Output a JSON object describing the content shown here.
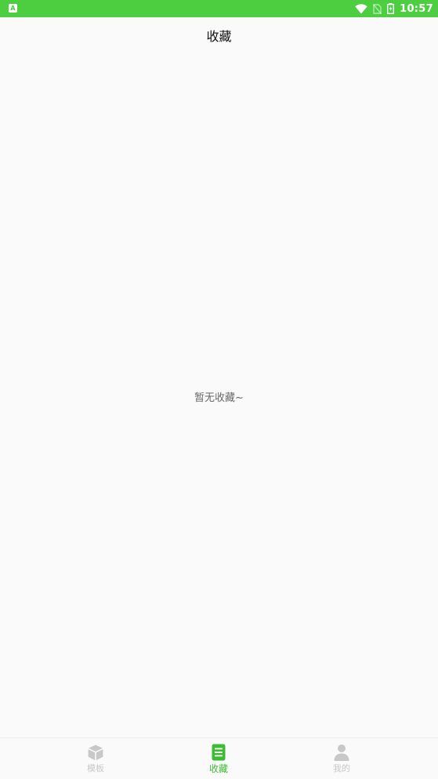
{
  "status_bar": {
    "left_icon": "A",
    "time": "10:57",
    "icons": [
      "wifi-icon",
      "no-sim-icon",
      "battery-icon"
    ],
    "background_color": "#4cce40"
  },
  "header": {
    "title": "收藏"
  },
  "main": {
    "empty_message": "暂无收藏~"
  },
  "bottom_nav": {
    "active_color": "#3dbb35",
    "inactive_color": "#c8c8c8",
    "items": [
      {
        "label": "模板",
        "icon": "cube-icon",
        "active": false
      },
      {
        "label": "收藏",
        "icon": "list-icon",
        "active": true
      },
      {
        "label": "我的",
        "icon": "person-icon",
        "active": false
      }
    ]
  }
}
